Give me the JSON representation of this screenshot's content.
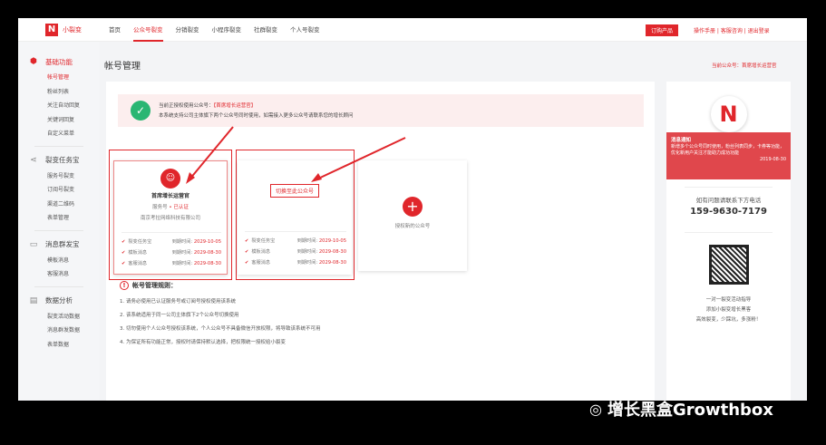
{
  "brand": "小裂变",
  "nav": [
    "首页",
    "公众号裂变",
    "分销裂变",
    "小程序裂变",
    "社群裂变",
    "个人号裂变"
  ],
  "nav_active": 1,
  "buy_label": "订购产品",
  "top_links": "操作手册 | 客服咨询 | 退出登录",
  "sidebar": [
    {
      "label": "基础功能",
      "icon": "cube-icon",
      "items": [
        "帐号管理",
        "粉丝列表",
        "关注自动回复",
        "关键词回复",
        "自定义菜单"
      ]
    },
    {
      "label": "裂变任务宝",
      "icon": "share-icon",
      "items": [
        "服务号裂变",
        "订阅号裂变",
        "渠道二维码",
        "表单管理"
      ]
    },
    {
      "label": "消息群发宝",
      "icon": "message-icon",
      "items": [
        "模板消息",
        "客服消息"
      ]
    },
    {
      "label": "数据分析",
      "icon": "data-icon",
      "items": [
        "裂变活动数据",
        "消息群发数据",
        "表单数据"
      ]
    }
  ],
  "page_title": "帐号管理",
  "current_account": "当前公众号：首席增长运营官",
  "notice": {
    "line1": "当前正授权使用公众号：",
    "account": "【首席增长运营官】",
    "line2": "本系统支持公司主体旗下两个公众号同时使用，如需接入更多公众号请联系您的增长顾问"
  },
  "cards": {
    "name": "首席增长运营官",
    "type": "服务号",
    "verified": "• 已认证",
    "company": "南京考拉网络科技有限公司",
    "switch_label": "切换至此公众号",
    "features": [
      {
        "name": "裂变任务宝",
        "expire_label": "到期时间:",
        "date": "2029-10-05"
      },
      {
        "name": "模板消息",
        "expire_label": "到期时间:",
        "date": "2029-08-30"
      },
      {
        "name": "客服消息",
        "expire_label": "到期时间:",
        "date": "2029-08-30"
      }
    ],
    "add_label": "授权新的公众号"
  },
  "rules": {
    "title": "帐号管理规则：",
    "items": [
      "1. 请务必使用已认证服务号或订阅号授权使用该系统",
      "2. 该系统适用于同一公司主体旗下2个公众号切换使用",
      "3. 切勿使用个人公众号授权该系统，个人公众号不具备微信开放权限，将导致该系统不可用",
      "4. 为保证所有功能正常，授权时请保持默认选择，把权限统一授权给小裂变"
    ]
  },
  "right": {
    "msg_title": "消息通知",
    "msg_body": "新增多个公众号同时使用，粉丝列表同步，卡券等功能，优化新用户关注才能助力成功功能",
    "msg_date": "2019-08-30",
    "contact": "如有问题请联系下方电话",
    "phone": "159-9630-7179",
    "qr_text": [
      "一对一裂变活动指导",
      "添加小裂变增长黑客",
      "高效裂变，少踩坑，多涨粉！"
    ]
  },
  "watermark": "增长黑盒Growthbox"
}
